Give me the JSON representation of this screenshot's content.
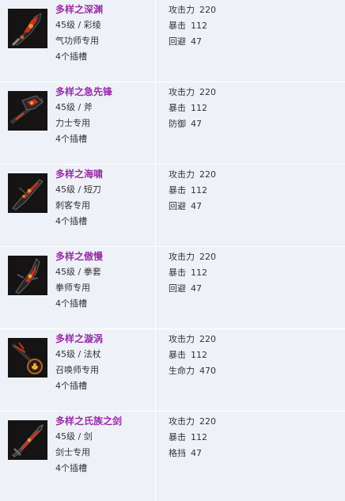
{
  "items": [
    {
      "name": "多样之深渊",
      "level": "45级",
      "separator": "/",
      "type": "彩绫",
      "class": "气功师专用",
      "slots": "4个插槽",
      "icon": "dagger-weapon-icon",
      "stats": [
        {
          "label": "攻击力",
          "value": "220"
        },
        {
          "label": "暴击",
          "value": "112"
        },
        {
          "label": "回避",
          "value": "47"
        }
      ]
    },
    {
      "name": "多样之急先锋",
      "level": "45级",
      "separator": "/",
      "type": "斧",
      "class": "力士专用",
      "slots": "4个插槽",
      "icon": "axe-weapon-icon",
      "stats": [
        {
          "label": "攻击力",
          "value": "220"
        },
        {
          "label": "暴击",
          "value": "112"
        },
        {
          "label": "防御",
          "value": "47"
        }
      ]
    },
    {
      "name": "多样之海啸",
      "level": "45级",
      "separator": "/",
      "type": "短刀",
      "class": "刺客专用",
      "slots": "4个插槽",
      "icon": "short-blade-weapon-icon",
      "stats": [
        {
          "label": "攻击力",
          "value": "220"
        },
        {
          "label": "暴击",
          "value": "112"
        },
        {
          "label": "回避",
          "value": "47"
        }
      ]
    },
    {
      "name": "多样之傲慢",
      "level": "45级",
      "separator": "/",
      "type": "拳套",
      "class": "拳师专用",
      "slots": "4个插槽",
      "icon": "gauntlet-weapon-icon",
      "stats": [
        {
          "label": "攻击力",
          "value": "220"
        },
        {
          "label": "暴击",
          "value": "112"
        },
        {
          "label": "回避",
          "value": "47"
        }
      ]
    },
    {
      "name": "多样之漩涡",
      "level": "45级",
      "separator": "/",
      "type": "法杖",
      "class": "召唤师专用",
      "slots": "4个插槽",
      "icon": "staff-weapon-icon",
      "stats": [
        {
          "label": "攻击力",
          "value": "220"
        },
        {
          "label": "暴击",
          "value": "112"
        },
        {
          "label": "生命力",
          "value": "470"
        }
      ]
    },
    {
      "name": "多样之氏族之剑",
      "level": "45级",
      "separator": "/",
      "type": "剑",
      "class": "剑士专用",
      "slots": "4个插槽",
      "icon": "sword-weapon-icon",
      "stats": [
        {
          "label": "攻击力",
          "value": "220"
        },
        {
          "label": "暴击",
          "value": "112"
        },
        {
          "label": "格挡",
          "value": "47"
        }
      ]
    }
  ],
  "colors": {
    "name": "#9a2ca8",
    "text": "#333333",
    "background": "#eef2f8",
    "divider": "#ffffff",
    "weapon_red": "#c8321e",
    "weapon_dark": "#2a2626"
  }
}
